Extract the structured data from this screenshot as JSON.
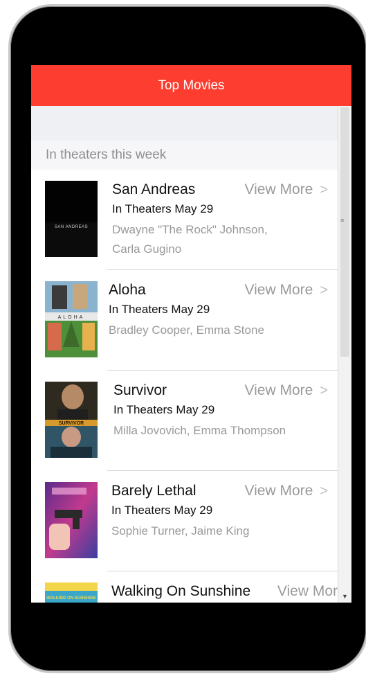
{
  "app": {
    "title": "Top Movies"
  },
  "section": {
    "header": "In theaters this week"
  },
  "movies": [
    {
      "title": "San Andreas",
      "date": "In Theaters May 29",
      "cast": "Dwayne \"The Rock\" Johnson, Carla Gugino",
      "poster_text": "SAN ANDREAS",
      "view_more": "View More"
    },
    {
      "title": "Aloha",
      "date": "In Theaters May 29",
      "cast": "Bradley Cooper, Emma Stone",
      "poster_text": "ALOHA",
      "view_more": "View More"
    },
    {
      "title": "Survivor",
      "date": "In Theaters May 29",
      "cast": "Milla Jovovich, Emma Thompson",
      "poster_text": "SURVIVOR",
      "view_more": "View More"
    },
    {
      "title": "Barely Lethal",
      "date": "In Theaters May 29",
      "cast": "Sophie Turner, Jaime King",
      "poster_text": "",
      "view_more": "View More"
    },
    {
      "title": "Walking On Sunshine",
      "date": "",
      "cast": "",
      "poster_text": "WALKING ON SUNSHINE",
      "view_more": "View Mor"
    }
  ],
  "colors": {
    "appbar": "#fc3d2f",
    "section_bg": "#f6f6f8",
    "subtle_text": "#999999"
  },
  "icons": {
    "chevron": "chevron-right-icon",
    "scroll_down": "scroll-down-arrow-icon"
  }
}
